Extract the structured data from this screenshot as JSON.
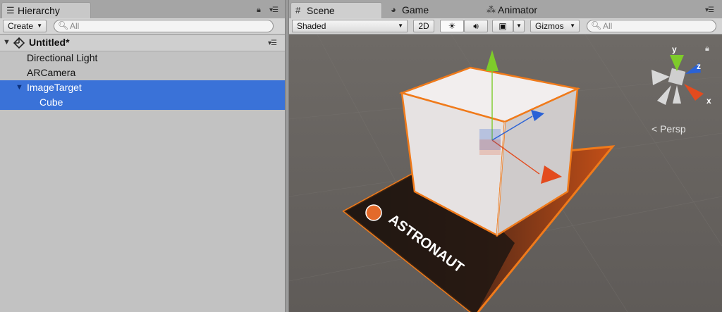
{
  "hierarchy": {
    "tab_label": "Hierarchy",
    "create_label": "Create",
    "search_placeholder": "All",
    "scene_name": "Untitled*",
    "items": [
      {
        "label": "Directional Light"
      },
      {
        "label": "ARCamera"
      },
      {
        "label": "ImageTarget"
      },
      {
        "label": "Cube"
      }
    ]
  },
  "scene": {
    "tabs": [
      {
        "label": "Scene"
      },
      {
        "label": "Game"
      },
      {
        "label": "Animator"
      }
    ],
    "shading_mode": "Shaded",
    "mode_2d": "2D",
    "gizmos_label": "Gizmos",
    "search_placeholder": "All",
    "persp_label": "Persp",
    "axes": {
      "x": "x",
      "y": "y",
      "z": "z"
    },
    "target_title": "ASTRONAUT"
  },
  "colors": {
    "selection": "#3a72d8",
    "scene_bg": "#6a6662",
    "selection_outline": "#f07a1a",
    "x_axis": "#e34b1e",
    "y_axis": "#7ecb2a",
    "z_axis": "#2a62d6"
  }
}
